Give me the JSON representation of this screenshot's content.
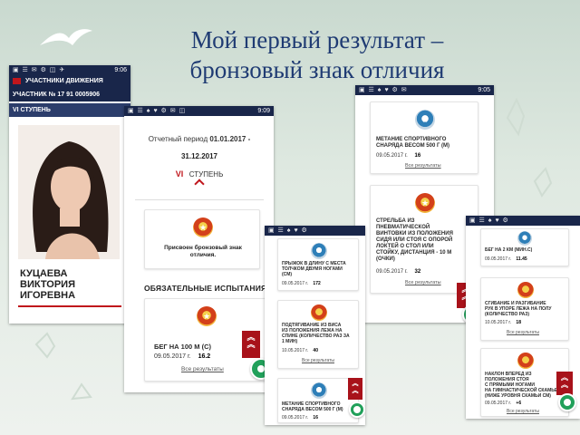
{
  "slide": {
    "title_line1": "Мой первый результат –",
    "title_line2": "бронзовый знак отличия"
  },
  "phone1": {
    "status_time": "9:06",
    "header_label": "УЧАСТНИКИ ДВИЖЕНИЯ",
    "participant_id": "УЧАСТНИК № 17 91 0005906",
    "stage_label": "VI СТУПЕНЬ",
    "name_lines": [
      "КУЦАЕВА",
      "ВИКТОРИЯ",
      "ИГОРЕВНА"
    ]
  },
  "phone2": {
    "status_time": "9:09",
    "period_label": "Отчетный период",
    "period_from": "01.01.2017 -",
    "period_to": "31.12.2017",
    "stage_numeral": "VI",
    "stage_word": "СТУПЕНЬ",
    "award_text_line1": "Присвоен бронзовый знак",
    "award_text_line2": "отличия.",
    "section_title": "ОБЯЗАТЕЛЬНЫЕ ИСПЫТАНИЯ",
    "test_name": "БЕГ НА 100 М (С)",
    "test_date": "09.05.2017 г.",
    "test_result": "16.2",
    "all_results_link": "Все результаты"
  },
  "phone3": {
    "status_time": "9:05",
    "card1_title_line1": "МЕТАНИЕ СПОРТИВНОГО",
    "card1_title_line2": "СНАРЯДА ВЕСОМ 500 Г (М)",
    "card1_date": "09.05.2017 г.",
    "card1_result": "16",
    "card1_link": "Все результаты",
    "card2_title_lines": [
      "СТРЕЛЬБА ИЗ",
      "ПНЕВМАТИЧЕСКОЙ",
      "ВИНТОВКИ ИЗ ПОЛОЖЕНИЯ",
      "СИДЯ ИЛИ СТОЯ С ОПОРОЙ",
      "ЛОКТЕЙ О СТОЛ ИЛИ",
      "СТОЙКУ, ДИСТАНЦИЯ - 10 М",
      "(ОЧКИ)"
    ],
    "card2_date": "09.05.2017 г.",
    "card2_result": "32",
    "card2_link": "Все результаты"
  },
  "phone4": {
    "card1_title_lines": [
      "ПРЫЖОК В ДЛИНУ С МЕСТА",
      "ТОЛЧКОМ ДВУМЯ НОГАМИ",
      "(СМ)"
    ],
    "card1_date": "09.05.2017 г.",
    "card1_result": "172",
    "card2_title_lines": [
      "ПОДТЯГИВАНИЕ ИЗ ВИСА",
      "ИЗ ПОЛОЖЕНИЯ ЛЕЖА НА",
      "СПИНЕ (КОЛИЧЕСТВО РАЗ ЗА",
      "1 МИН)"
    ],
    "card2_date": "10.05.2017 г.",
    "card2_result": "40",
    "card2_link": "Все результаты",
    "card3_title_lines": [
      "МЕТАНИЕ СПОРТИВНОГО",
      "СНАРЯДА ВЕСОМ 500 Г (М)"
    ],
    "card3_date": "09.05.2017 г.",
    "card3_result": "16"
  },
  "phone5": {
    "card1_title": "БЕГ НА 2 КМ (МИН.С)",
    "card1_date": "09.05.2017 г.",
    "card1_result": "11.45",
    "card2_title_lines": [
      "СГИБАНИЕ И РАЗГИБАНИЕ",
      "РУК В УПОРЕ ЛЕЖА НА ПОЛУ",
      "(КОЛИЧЕСТВО РАЗ)"
    ],
    "card2_date": "10.05.2017 г.",
    "card2_result": "18",
    "card2_link": "Все результаты",
    "card3_title_lines": [
      "НАКЛОН ВПЕРЕД ИЗ",
      "ПОЛОЖЕНИЯ СТОЯ",
      "С ПРЯМЫМИ НОГАМИ",
      "НА ГИМНАСТИЧЕСКОЙ СКАМЬЕ",
      "(НИЖЕ УРОВНЯ СКАМЬИ СМ)"
    ],
    "card3_date": "09.05.2017 г.",
    "card3_result": "+6",
    "card3_link": "Все результаты"
  },
  "colors": {
    "title": "#1f3b73",
    "status_bar": "#19264a",
    "brand_red": "#c0161c",
    "fab_green": "#21a05a"
  },
  "icons": [
    "bird-logo-icon",
    "menu-icon",
    "bronze-badge-icon",
    "silver-badge-icon",
    "chevron-up-icon",
    "scroll-top-icon",
    "chat-icon"
  ]
}
